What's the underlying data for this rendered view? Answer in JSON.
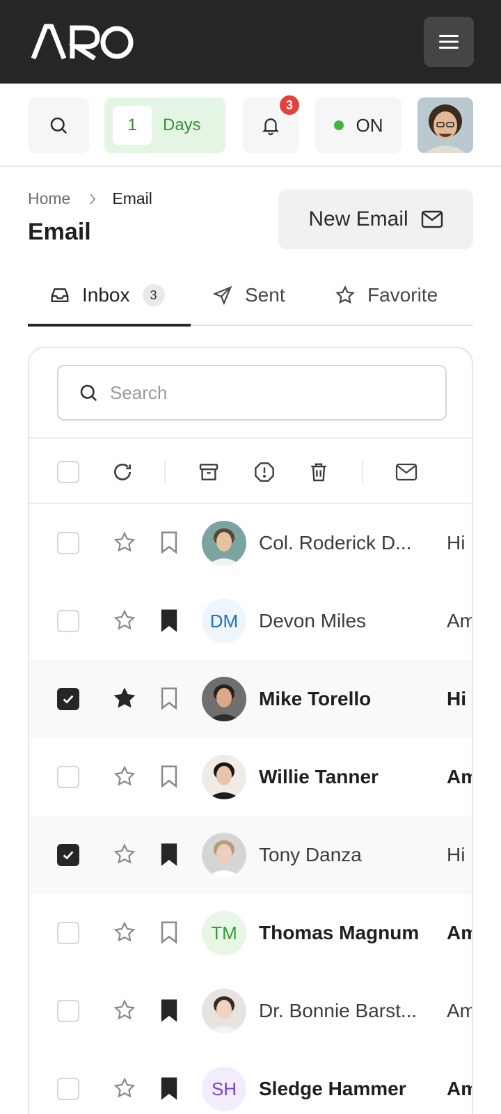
{
  "app": {
    "logo_text": "ARO"
  },
  "toolbar": {
    "days_value": "1",
    "days_label": "Days",
    "notifications_count": "3",
    "status_label": "ON"
  },
  "breadcrumb": {
    "home": "Home",
    "current": "Email"
  },
  "page": {
    "title": "Email",
    "new_email_label": "New Email"
  },
  "tabs": [
    {
      "label": "Inbox",
      "count": "3",
      "icon": "inbox-icon",
      "active": true
    },
    {
      "label": "Sent",
      "icon": "send-icon"
    },
    {
      "label": "Favorite",
      "icon": "star-icon"
    }
  ],
  "search": {
    "placeholder": "Search"
  },
  "emails": [
    {
      "name": "Col. Roderick D...",
      "snippet": "Hi I",
      "avatar_type": "photo",
      "checked": false,
      "starred": false,
      "bookmarked": false,
      "unread": false
    },
    {
      "name": "Devon Miles",
      "snippet": "Am",
      "avatar_type": "initials",
      "initials": "DM",
      "initials_color": "#1e6fd1",
      "initials_bg": "#eef5fd",
      "checked": false,
      "starred": false,
      "bookmarked": true,
      "unread": false
    },
    {
      "name": "Mike Torello",
      "snippet": "Hi I",
      "avatar_type": "photo",
      "checked": true,
      "starred": true,
      "bookmarked": false,
      "unread": true
    },
    {
      "name": "Willie Tanner",
      "snippet": "Am",
      "avatar_type": "photo",
      "checked": false,
      "starred": false,
      "bookmarked": false,
      "unread": true
    },
    {
      "name": "Tony Danza",
      "snippet": "Hi I",
      "avatar_type": "photo",
      "checked": true,
      "starred": false,
      "bookmarked": true,
      "unread": false
    },
    {
      "name": "Thomas Magnum",
      "snippet": "Am",
      "avatar_type": "initials",
      "initials": "TM",
      "initials_color": "#3a9a3a",
      "initials_bg": "#e8f6e6",
      "checked": false,
      "starred": false,
      "bookmarked": false,
      "unread": true
    },
    {
      "name": "Dr. Bonnie Barst...",
      "snippet": "Am",
      "avatar_type": "photo",
      "checked": false,
      "starred": false,
      "bookmarked": true,
      "unread": false
    },
    {
      "name": "Sledge Hammer",
      "snippet": "Am",
      "avatar_type": "initials",
      "initials": "SH",
      "initials_color": "#7a3fd6",
      "initials_bg": "#f2ecfc",
      "checked": false,
      "starred": false,
      "bookmarked": true,
      "unread": true
    }
  ]
}
